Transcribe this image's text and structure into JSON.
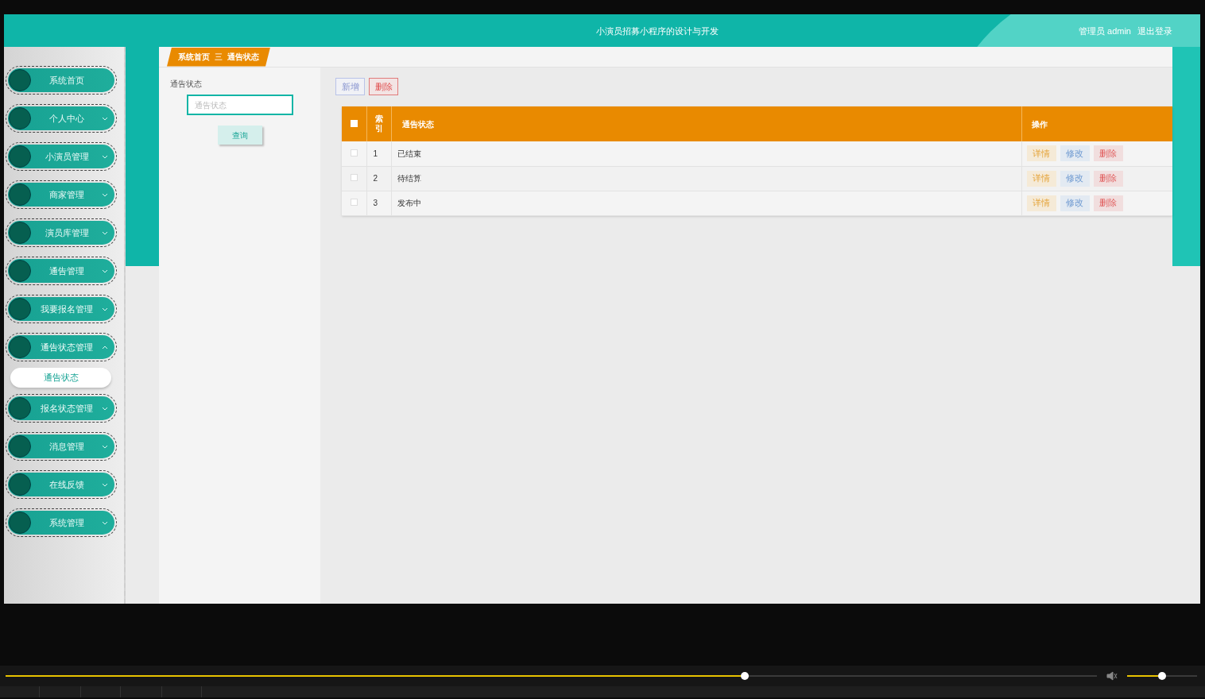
{
  "header": {
    "title": "小演员招募小程序的设计与开发",
    "user": "管理员 admin",
    "logout": "退出登录"
  },
  "sidebar": {
    "items": [
      {
        "label": "系统首页",
        "kind": "link"
      },
      {
        "label": "个人中心",
        "kind": "menu",
        "expanded": false
      },
      {
        "label": "小演员管理",
        "kind": "menu",
        "expanded": false
      },
      {
        "label": "商家管理",
        "kind": "menu",
        "expanded": false
      },
      {
        "label": "演员库管理",
        "kind": "menu",
        "expanded": false
      },
      {
        "label": "通告管理",
        "kind": "menu",
        "expanded": false
      },
      {
        "label": "我要报名管理",
        "kind": "menu",
        "expanded": false
      },
      {
        "label": "通告状态管理",
        "kind": "menu",
        "expanded": true,
        "children": [
          {
            "label": "通告状态"
          }
        ]
      },
      {
        "label": "报名状态管理",
        "kind": "menu",
        "expanded": false
      },
      {
        "label": "消息管理",
        "kind": "menu",
        "expanded": false
      },
      {
        "label": "在线反馈",
        "kind": "menu",
        "expanded": false
      },
      {
        "label": "系统管理",
        "kind": "menu",
        "expanded": false
      }
    ]
  },
  "breadcrumb": {
    "items": [
      "系统首页",
      "通告状态"
    ],
    "separator": "三"
  },
  "search": {
    "label": "通告状态",
    "placeholder": "通告状态",
    "button": "查询"
  },
  "toolbar": {
    "buttons": [
      {
        "label": "新增",
        "kind": "add"
      },
      {
        "label": "删除",
        "kind": "delete"
      }
    ]
  },
  "table": {
    "select_all": {
      "checked": false
    },
    "columns": [
      "索引",
      "通告状态",
      "操作"
    ],
    "rows": [
      {
        "checked": false,
        "index": "1",
        "status": "已结束",
        "actions": [
          {
            "label": "详情",
            "kind": "detail"
          },
          {
            "label": "修改",
            "kind": "edit"
          },
          {
            "label": "删除",
            "kind": "delete"
          }
        ]
      },
      {
        "checked": false,
        "index": "2",
        "status": "待结算",
        "actions": [
          {
            "label": "详情",
            "kind": "detail"
          },
          {
            "label": "修改",
            "kind": "edit"
          },
          {
            "label": "删除",
            "kind": "delete"
          }
        ]
      },
      {
        "checked": false,
        "index": "3",
        "status": "发布中",
        "actions": [
          {
            "label": "详情",
            "kind": "detail"
          },
          {
            "label": "修改",
            "kind": "edit"
          },
          {
            "label": "删除",
            "kind": "delete"
          }
        ]
      }
    ]
  },
  "player": {
    "progress": {
      "level": 0.674
    },
    "volume": {
      "level": 0.44
    }
  }
}
